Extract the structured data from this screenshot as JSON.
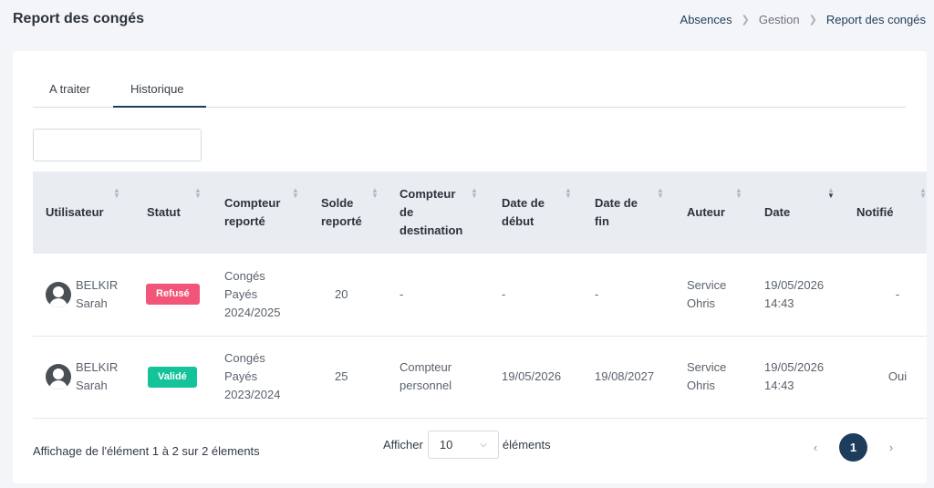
{
  "header": {
    "title": "Report des congés",
    "breadcrumb": [
      "Absences",
      "Gestion",
      "Report des congés"
    ]
  },
  "tabs": [
    {
      "label": "A traiter",
      "active": false
    },
    {
      "label": "Historique",
      "active": true
    }
  ],
  "search": {
    "value": "",
    "placeholder": ""
  },
  "table": {
    "columns": [
      "Utilisateur",
      "Statut",
      "Compteur reporté",
      "Solde reporté",
      "Compteur de destination",
      "Date de début",
      "Date de fin",
      "Auteur",
      "Date",
      "Notifié"
    ],
    "rows": [
      {
        "user_first": "BELKIR",
        "user_last": "Sarah",
        "status": "Refusé",
        "status_color": "#f25577",
        "counter_l1": "Congés",
        "counter_l2": "Payés",
        "counter_l3": "2024/2025",
        "balance": "20",
        "dest_l1": "-",
        "dest_l2": "",
        "start": "-",
        "end": "-",
        "author_l1": "Service",
        "author_l2": "Ohris",
        "date_l1": "19/05/2026",
        "date_l2": "14:43",
        "notified": "-"
      },
      {
        "user_first": "BELKIR",
        "user_last": "Sarah",
        "status": "Validé",
        "status_color": "#14c39a",
        "counter_l1": "Congés",
        "counter_l2": "Payés",
        "counter_l3": "2023/2024",
        "balance": "25",
        "dest_l1": "Compteur",
        "dest_l2": "personnel",
        "start": "19/05/2026",
        "end": "19/08/2027",
        "author_l1": "Service",
        "author_l2": "Ohris",
        "date_l1": "19/05/2026",
        "date_l2": "14:43",
        "notified": "Oui"
      }
    ]
  },
  "footer": {
    "info": "Affichage de l'élément 1 à 2 sur 2 élements",
    "show_label": "Afficher",
    "per_page": "10",
    "elements_label": "éléments",
    "current_page": "1",
    "prev_icon": "‹",
    "next_icon": "›"
  },
  "colors": {
    "accent": "#1e3d5c",
    "refused": "#f25577",
    "validated": "#14c39a"
  }
}
